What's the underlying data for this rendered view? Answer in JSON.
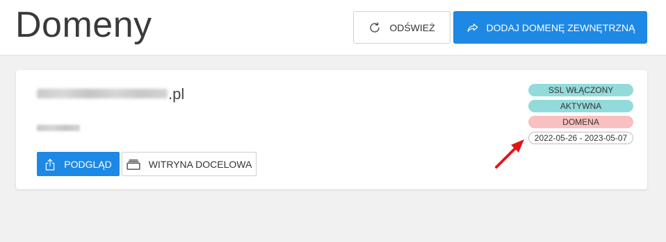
{
  "header": {
    "title": "Domeny",
    "refresh_label": "ODŚWIEŻ",
    "add_external_domain_label": "DODAJ DOMENĘ ZEWNĘTRZNĄ"
  },
  "domain_card": {
    "name_suffix": ".pl",
    "preview_label": "PODGLĄD",
    "target_site_label": "WITRYNA DOCELOWA",
    "badges": {
      "ssl": "SSL WŁĄCZONY",
      "status": "AKTYWNA",
      "type": "DOMENA",
      "dates": "2022-05-26 - 2023-05-07"
    }
  },
  "colors": {
    "accent": "#1e88e5",
    "badge_teal": "#93dbdb",
    "badge_pink": "#f8c0c0",
    "annotation_arrow": "#e0161b"
  },
  "icons": {
    "refresh": "refresh-icon",
    "share": "share-forward-icon",
    "upload": "upload-icon",
    "layers": "layers-icon",
    "annotation": "red-arrow-icon"
  }
}
